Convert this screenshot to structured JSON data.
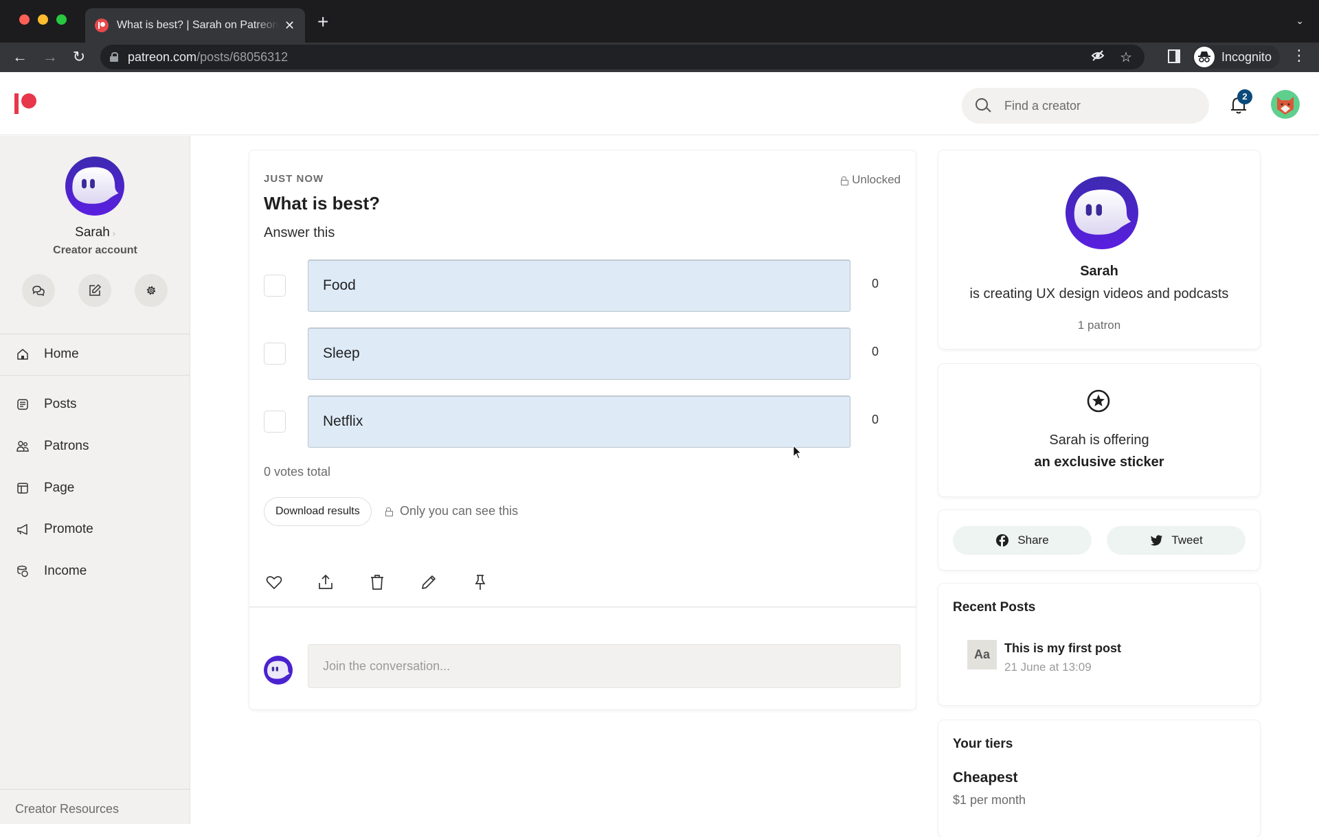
{
  "browser": {
    "tab_title": "What is best? | Sarah on Patreon",
    "url_host": "patreon.com",
    "url_path": "/posts/68056312",
    "profile_label": "Incognito"
  },
  "header": {
    "search_placeholder": "Find a creator",
    "notification_count": "2",
    "brand_color": "#e8364b"
  },
  "sidebar": {
    "user_name": "Sarah",
    "account_type": "Creator account",
    "quick_actions": [
      {
        "name": "messages",
        "icon": "chat-bubbles-icon"
      },
      {
        "name": "create-post",
        "icon": "edit-icon"
      },
      {
        "name": "settings",
        "icon": "gear-icon"
      }
    ],
    "items": [
      {
        "label": "Home",
        "icon": "home-icon"
      },
      {
        "label": "Posts",
        "icon": "posts-icon"
      },
      {
        "label": "Patrons",
        "icon": "patrons-icon"
      },
      {
        "label": "Page",
        "icon": "page-icon"
      },
      {
        "label": "Promote",
        "icon": "megaphone-icon"
      },
      {
        "label": "Income",
        "icon": "coins-icon"
      }
    ],
    "footer_link": "Creator Resources"
  },
  "post": {
    "timestamp": "JUST NOW",
    "access": "Unlocked",
    "title": "What is best?",
    "body": "Answer this",
    "poll": {
      "options": [
        {
          "label": "Food",
          "votes": "0"
        },
        {
          "label": "Sleep",
          "votes": "0"
        },
        {
          "label": "Netflix",
          "votes": "0"
        }
      ],
      "votes_total": "0 votes total",
      "download_label": "Download results",
      "private_note": "Only you can see this",
      "bar_color": "#deebf7"
    },
    "actions": [
      "like",
      "share",
      "delete",
      "edit",
      "pin"
    ],
    "comment_placeholder": "Join the conversation..."
  },
  "creator_card": {
    "name": "Sarah",
    "description": "is creating UX design videos and podcasts",
    "patrons": "1 patron"
  },
  "offer_card": {
    "line1": "Sarah is offering",
    "line2": "an exclusive sticker"
  },
  "share_card": {
    "share_label": "Share",
    "tweet_label": "Tweet"
  },
  "recent_posts": {
    "heading": "Recent Posts",
    "items": [
      {
        "thumb": "Aa",
        "title": "This is my first post",
        "date": "21 June at 13:09"
      }
    ]
  },
  "tiers": {
    "heading": "Your tiers",
    "items": [
      {
        "name": "Cheapest",
        "price": "$1 per month"
      }
    ]
  }
}
